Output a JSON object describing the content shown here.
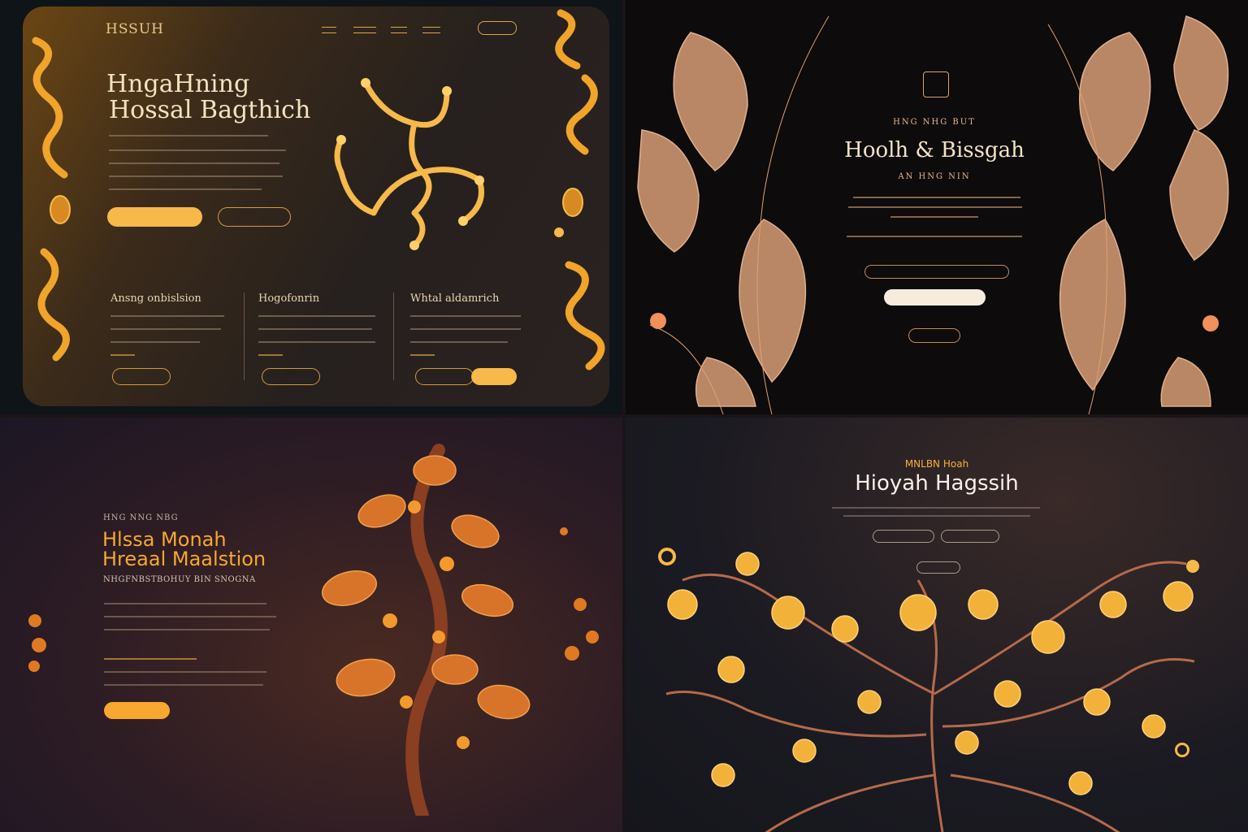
{
  "quad1": {
    "logo": "HSSUH",
    "title": [
      "HngaHning",
      "Hossal Bagthich"
    ],
    "columns": [
      {
        "title": "Ansng onbislsion"
      },
      {
        "title": "Hogofonrin"
      },
      {
        "title": "Whtal aldamrich"
      }
    ]
  },
  "quad2": {
    "kicker": "HNG NHG BUT",
    "title": "Hoolh & Bissgah",
    "subtitle": "AN HNG NIN"
  },
  "quad3": {
    "kicker": "HNG NNG NBG",
    "title": [
      "Hlssa Monah",
      "Hreaal Maalstion"
    ],
    "subtitle": "NHGFNBSTBOHUY BIN SNOGNA"
  },
  "quad4": {
    "kicker": "MNLBN Hoah",
    "title": "Hioyah Hagssih"
  },
  "colors": {
    "gold": "#f6b94a",
    "copper": "#c47a4a",
    "cream": "#f3e2c0",
    "orange": "#f6a830"
  }
}
